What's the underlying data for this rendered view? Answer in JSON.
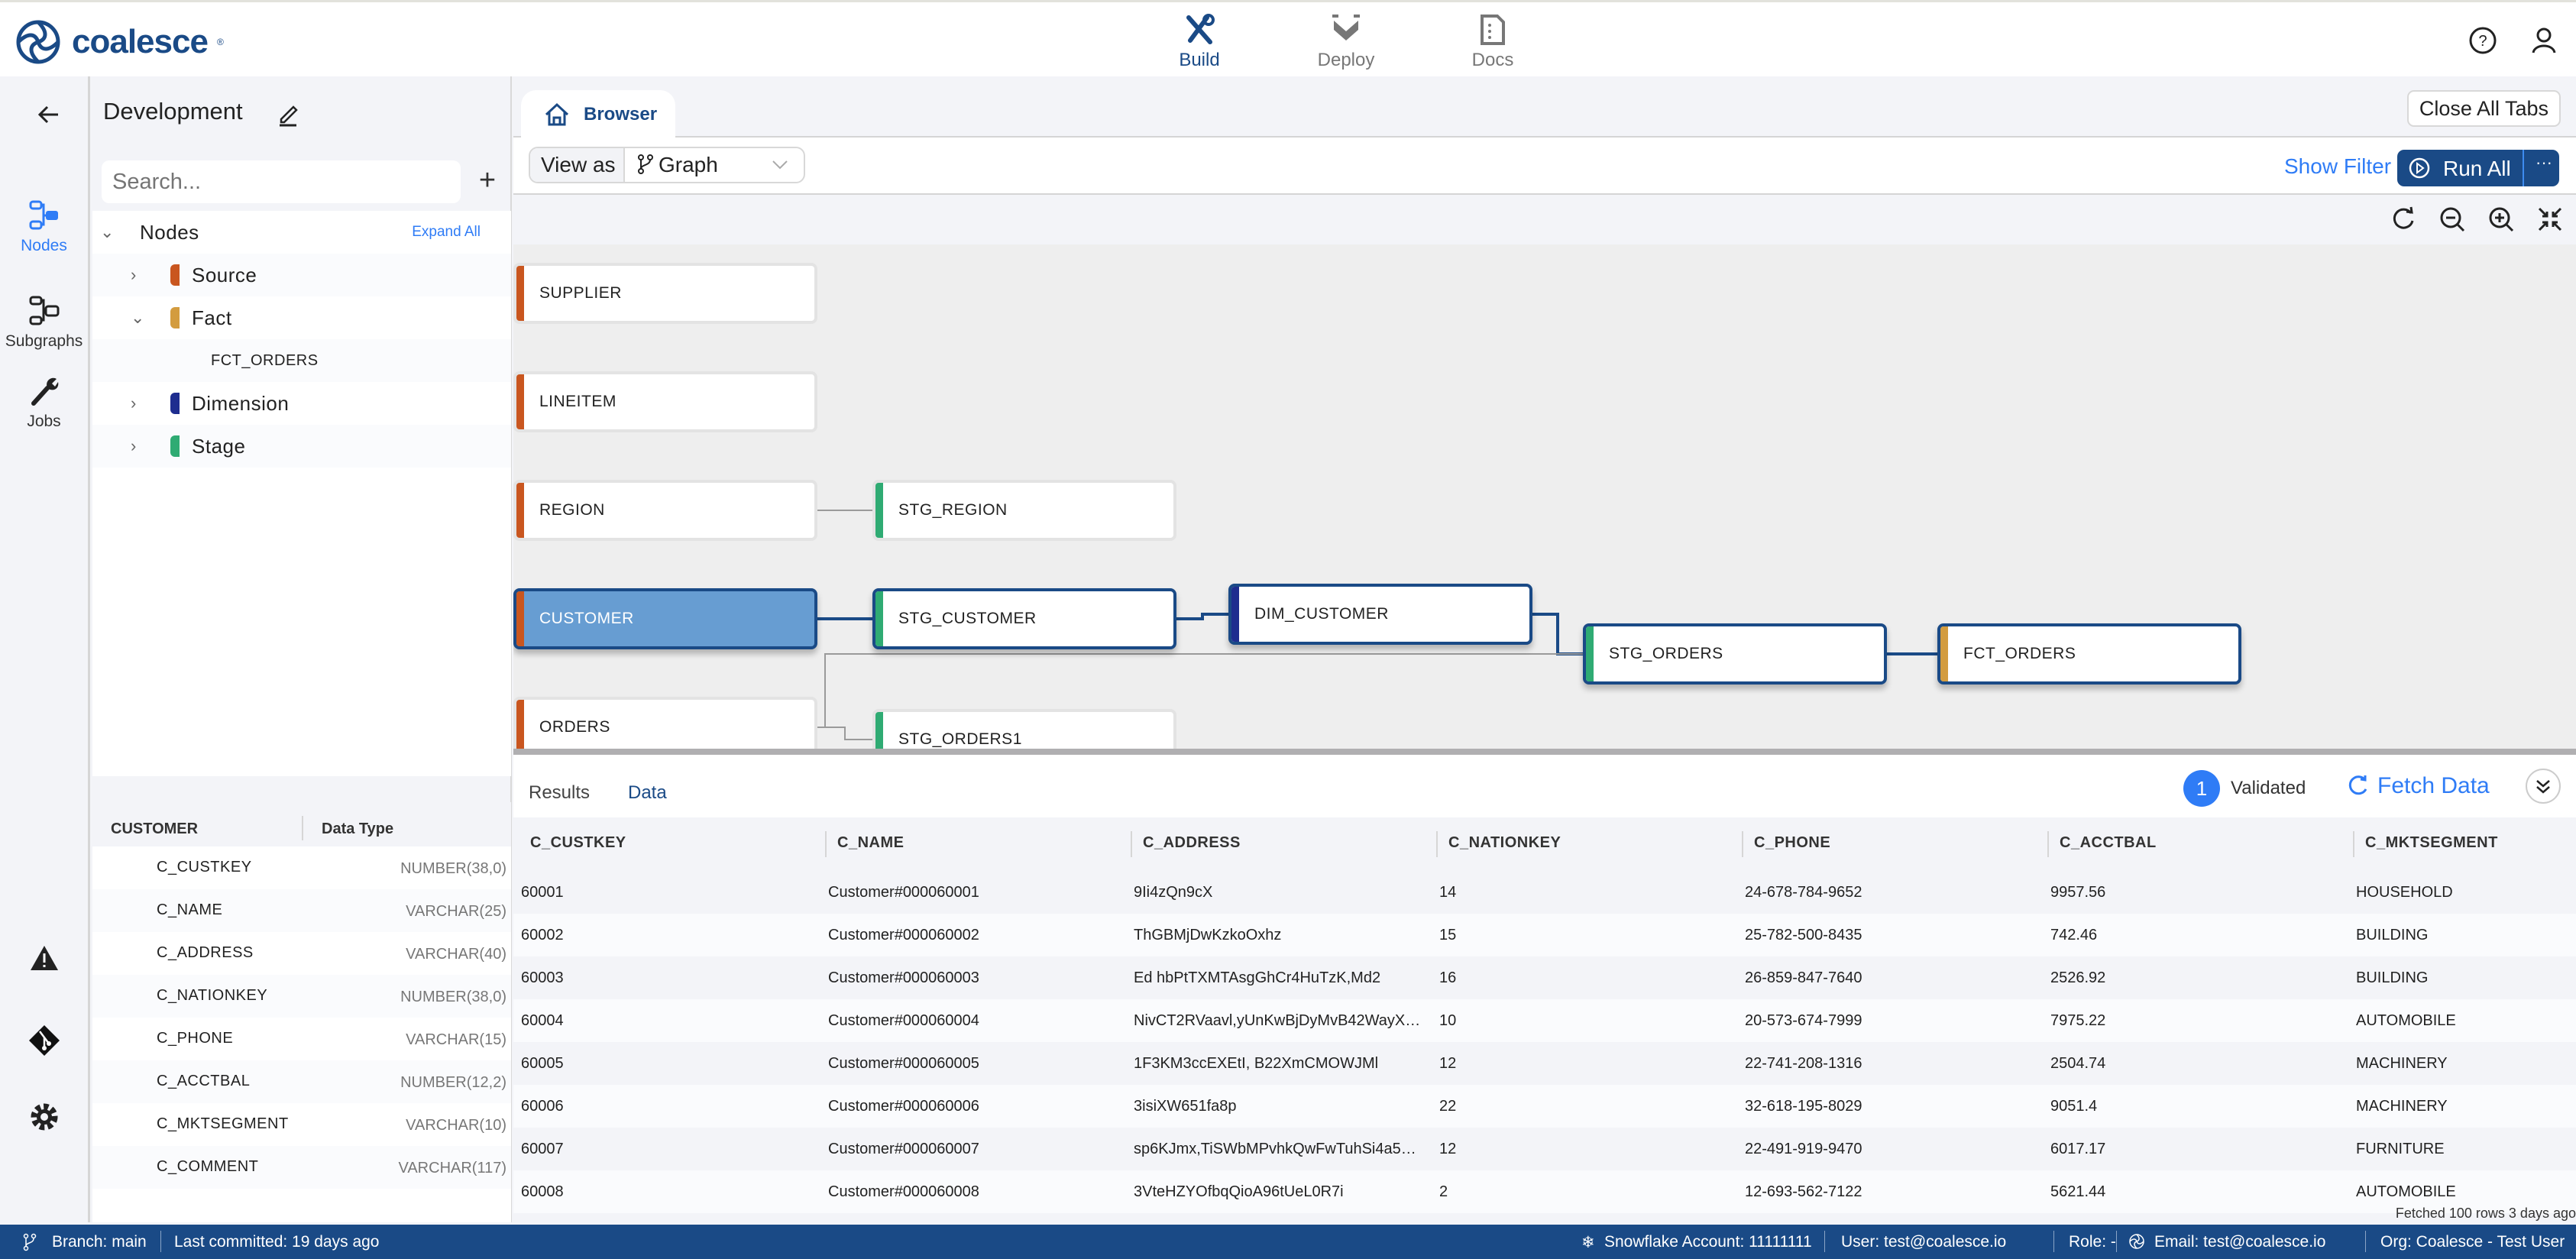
{
  "header": {
    "brand": "coalesce",
    "nav": [
      {
        "label": "Build",
        "icon": "build-tools-icon",
        "active": true
      },
      {
        "label": "Deploy",
        "icon": "deploy-icon",
        "active": false
      },
      {
        "label": "Docs",
        "icon": "docs-icon",
        "active": false
      }
    ],
    "help_icon": "help-icon",
    "user_icon": "user-icon"
  },
  "rail": {
    "items": [
      {
        "label": "Nodes",
        "active": true
      },
      {
        "label": "Subgraphs",
        "active": false
      },
      {
        "label": "Jobs",
        "active": false
      }
    ],
    "bottom_icons": [
      "warning-icon",
      "git-icon",
      "settings-icon"
    ]
  },
  "workspace": {
    "title": "Development",
    "search_placeholder": "Search...",
    "add_label": "+"
  },
  "tree": {
    "root_label": "Nodes",
    "expand_all": "Expand All",
    "groups": [
      {
        "label": "Source",
        "color": "#c9561f",
        "expanded": false
      },
      {
        "label": "Fact",
        "color": "#d39c3f",
        "expanded": true,
        "children": [
          "FCT_ORDERS"
        ]
      },
      {
        "label": "Dimension",
        "color": "#1e2d8f",
        "expanded": false
      },
      {
        "label": "Stage",
        "color": "#2fab73",
        "expanded": false
      }
    ]
  },
  "columns_panel": {
    "node_name": "CUSTOMER",
    "type_header": "Data Type",
    "columns": [
      {
        "name": "C_CUSTKEY",
        "type": "NUMBER(38,0)"
      },
      {
        "name": "C_NAME",
        "type": "VARCHAR(25)"
      },
      {
        "name": "C_ADDRESS",
        "type": "VARCHAR(40)"
      },
      {
        "name": "C_NATIONKEY",
        "type": "NUMBER(38,0)"
      },
      {
        "name": "C_PHONE",
        "type": "VARCHAR(15)"
      },
      {
        "name": "C_ACCTBAL",
        "type": "NUMBER(12,2)"
      },
      {
        "name": "C_MKTSEGMENT",
        "type": "VARCHAR(10)"
      },
      {
        "name": "C_COMMENT",
        "type": "VARCHAR(117)"
      }
    ]
  },
  "tabs": {
    "browser_label": "Browser",
    "close_all": "Close All Tabs"
  },
  "toolbar": {
    "view_as_label": "View as",
    "view_as_value": "Graph",
    "show_filter": "Show Filter",
    "run_all": "Run All",
    "more": "···"
  },
  "graph": {
    "colors": {
      "source": "#c9561f",
      "stage": "#2fab73",
      "dimension": "#1e2d8f",
      "fact": "#d39c3f",
      "highlight": "#1a4a86",
      "selected_fill": "#679dd2"
    },
    "nodes": [
      {
        "id": "supplier",
        "label": "SUPPLIER",
        "type": "source"
      },
      {
        "id": "lineitem",
        "label": "LINEITEM",
        "type": "source"
      },
      {
        "id": "region",
        "label": "REGION",
        "type": "source"
      },
      {
        "id": "customer",
        "label": "CUSTOMER",
        "type": "source",
        "selected": true
      },
      {
        "id": "orders",
        "label": "ORDERS",
        "type": "source"
      },
      {
        "id": "stg_region",
        "label": "STG_REGION",
        "type": "stage"
      },
      {
        "id": "stg_customer",
        "label": "STG_CUSTOMER",
        "type": "stage",
        "highlighted": true
      },
      {
        "id": "stg_orders1",
        "label": "STG_ORDERS1",
        "type": "stage"
      },
      {
        "id": "dim_customer",
        "label": "DIM_CUSTOMER",
        "type": "dimension",
        "highlighted": true
      },
      {
        "id": "stg_orders",
        "label": "STG_ORDERS",
        "type": "stage",
        "highlighted": true
      },
      {
        "id": "fct_orders",
        "label": "FCT_ORDERS",
        "type": "fact",
        "highlighted": true
      }
    ],
    "edges": [
      [
        "region",
        "stg_region"
      ],
      [
        "customer",
        "stg_customer"
      ],
      [
        "stg_customer",
        "dim_customer"
      ],
      [
        "dim_customer",
        "stg_orders"
      ],
      [
        "orders",
        "stg_orders"
      ],
      [
        "orders",
        "stg_orders1"
      ],
      [
        "stg_orders",
        "fct_orders"
      ]
    ]
  },
  "results": {
    "tabs": [
      {
        "label": "Results",
        "active": false
      },
      {
        "label": "Data",
        "active": true
      }
    ],
    "validated_count": "1",
    "validated_label": "Validated",
    "fetch_label": "Fetch Data",
    "headers": [
      "C_CUSTKEY",
      "C_NAME",
      "C_ADDRESS",
      "C_NATIONKEY",
      "C_PHONE",
      "C_ACCTBAL",
      "C_MKTSEGMENT"
    ],
    "rows": [
      [
        "60001",
        "Customer#000060001",
        "9Ii4zQn9cX",
        "14",
        "24-678-784-9652",
        "9957.56",
        "HOUSEHOLD"
      ],
      [
        "60002",
        "Customer#000060002",
        "ThGBMjDwKzkoOxhz",
        "15",
        "25-782-500-8435",
        "742.46",
        "BUILDING"
      ],
      [
        "60003",
        "Customer#000060003",
        "Ed hbPtTXMTAsgGhCr4HuTzK,Md2",
        "16",
        "26-859-847-7640",
        "2526.92",
        "BUILDING"
      ],
      [
        "60004",
        "Customer#000060004",
        "NivCT2RVaavl,yUnKwBjDyMvB42WayX…",
        "10",
        "20-573-674-7999",
        "7975.22",
        "AUTOMOBILE"
      ],
      [
        "60005",
        "Customer#000060005",
        "1F3KM3ccEXEtI, B22XmCMOWJMl",
        "12",
        "22-741-208-1316",
        "2504.74",
        "MACHINERY"
      ],
      [
        "60006",
        "Customer#000060006",
        "3isiXW651fa8p",
        "22",
        "32-618-195-8029",
        "9051.4",
        "MACHINERY"
      ],
      [
        "60007",
        "Customer#000060007",
        "sp6KJmx,TiSWbMPvhkQwFwTuhSi4a5…",
        "12",
        "22-491-919-9470",
        "6017.17",
        "FURNITURE"
      ],
      [
        "60008",
        "Customer#000060008",
        "3VteHZYOfbqQioA96tUeL0R7i",
        "2",
        "12-693-562-7122",
        "5621.44",
        "AUTOMOBILE"
      ]
    ],
    "fetched_text": "Fetched 100 rows   3 days ago"
  },
  "status_bar": {
    "branch": "Branch: main",
    "last_committed": "Last committed: 19 days ago",
    "snowflake_account": "Snowflake Account: 11111111",
    "user": "User: test@coalesce.io",
    "role": "Role: -",
    "email": "Email: test@coalesce.io",
    "org": "Org: Coalesce - Test User"
  }
}
